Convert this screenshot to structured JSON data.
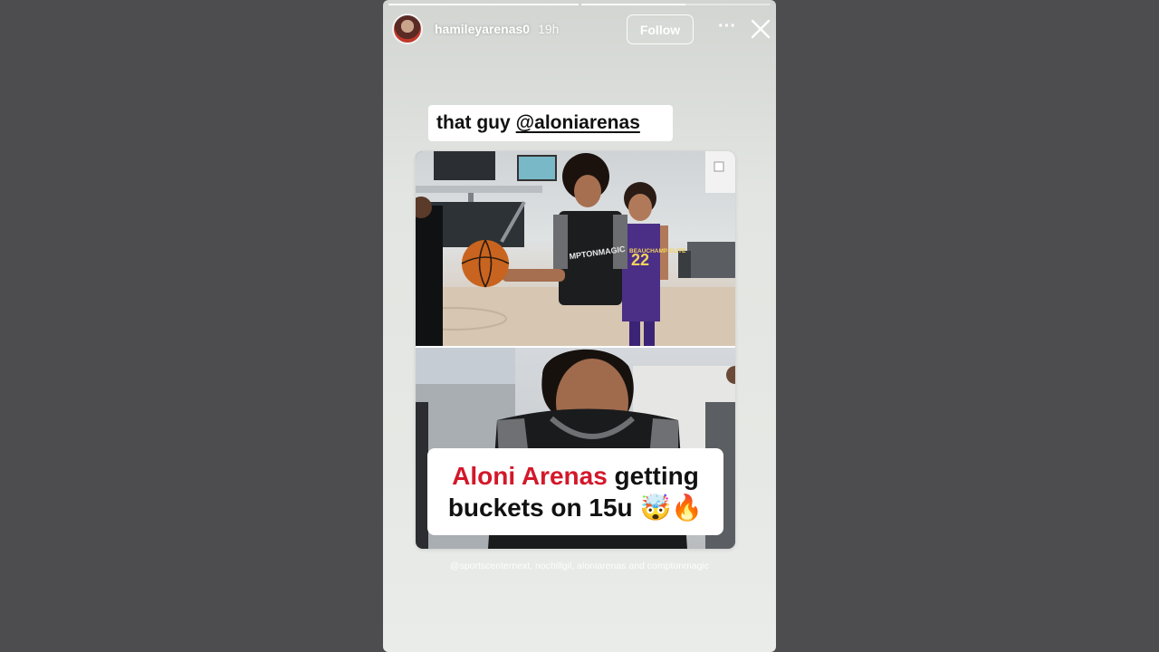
{
  "story": {
    "progress": [
      1,
      0.55
    ],
    "username": "hamileyarenas0",
    "time": "19h",
    "follow_label": "Follow",
    "more_label": "···",
    "caption_text": "that guy",
    "caption_mention": "@aloniarenas",
    "post": {
      "headline_red": "Aloni Arenas",
      "headline_rest": " getting",
      "headline_line2": "buckets on 15u",
      "headline_emoji": "🤯🔥",
      "jersey_number": "22",
      "jersey_text": "BEAUCHAMP ELITE"
    },
    "tags_text": "@sportscenternext, nochillgil, aloniarenas and comptonmagic"
  },
  "colors": {
    "page_background": "#4d4d4f",
    "headline_red": "#d3182a"
  },
  "icons": [
    "close-icon",
    "more-icon"
  ]
}
